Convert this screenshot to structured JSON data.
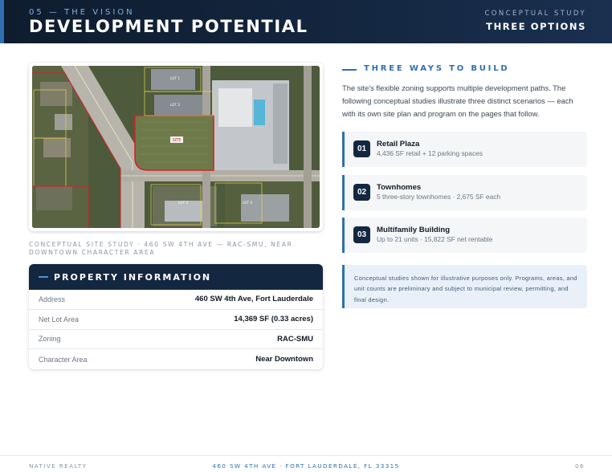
{
  "header": {
    "kicker": "05 — THE VISION",
    "title": "DEVELOPMENT POTENTIAL",
    "right_kicker": "CONCEPTUAL STUDY",
    "right_title": "THREE OPTIONS"
  },
  "map": {
    "site_label": "SITE",
    "lot_labels": [
      "LOT 1",
      "LOT 2",
      "LOT 3",
      "LOT 4"
    ]
  },
  "caption": "CONCEPTUAL SITE STUDY · 460 SW 4TH AVE — RAC-SMU, NEAR DOWNTOWN CHARACTER AREA",
  "property": {
    "title": "PROPERTY INFORMATION",
    "rows": [
      {
        "key": "Address",
        "value": "460 SW 4th Ave, Fort Lauderdale"
      },
      {
        "key": "Net Lot Area",
        "value": "14,369 SF (0.33 acres)"
      },
      {
        "key": "Zoning",
        "value": "RAC-SMU"
      },
      {
        "key": "Character Area",
        "value": "Near Downtown"
      }
    ]
  },
  "section": {
    "title": "THREE WAYS TO BUILD",
    "intro": "The site's flexible zoning supports multiple development paths. The following conceptual studies illustrate three distinct scenarios — each with its own site plan and program on the pages that follow."
  },
  "options": [
    {
      "num": "01",
      "name": "Retail Plaza",
      "desc": "4,436 SF retail + 12 parking spaces"
    },
    {
      "num": "02",
      "name": "Townhomes",
      "desc": "5 three-story townhomes · 2,675 SF each"
    },
    {
      "num": "03",
      "name": "Multifamily Building",
      "desc": "Up to 21 units · 15,822 SF net rentable"
    }
  ],
  "note": "Conceptual studies shown for illustrative purposes only. Programs, areas, and unit counts are preliminary and subject to municipal review, permitting, and final design.",
  "footer": {
    "left": "NATIVE REALTY",
    "center": "460 SW 4TH AVE · FORT LAUDERDALE, FL 33315",
    "right": "06"
  },
  "colors": {
    "navy": "#142741",
    "accent": "#2f6fb0",
    "parcel_outline": "#d4222a"
  }
}
